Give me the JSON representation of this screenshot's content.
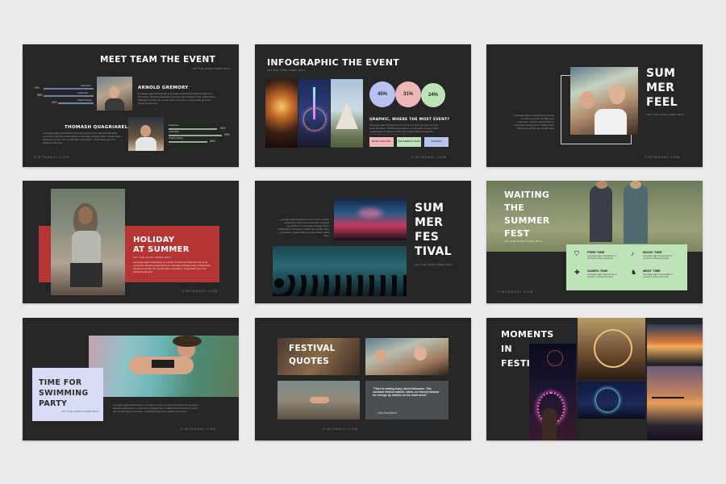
{
  "footer_url": "XINTAMANI.COM",
  "tagline": "LET THE GOOD TIMES ROLL",
  "lorem": "Leverage agile frameworks to provide a robust synopsis for high level overviews. Iterative approaches to corporate strategy foster collaborative thinking to further the overall value proposition. Organically grow the holistic world view.",
  "slide1": {
    "title": "MEET TEAM THE EVENT",
    "person1": "ARNOLD GREMORY",
    "person2": "THOMASH QUAGRIARELA",
    "pct1": [
      "70%",
      "85%",
      "60%"
    ],
    "pct2": [
      "80%",
      "90%",
      "65%"
    ],
    "skills": [
      "Ilustrations",
      "Leadership",
      "Graphic Design"
    ],
    "colors": {
      "bar_a": "#6f80a8",
      "bar_b": "#8fb08b"
    }
  },
  "slide2": {
    "title": "INFOGRAPHIC THE EVENT",
    "bubbles": [
      {
        "value": "45%",
        "color": "#b9c3f2"
      },
      {
        "value": "31%",
        "color": "#efb7b9"
      },
      {
        "value": "24%",
        "color": "#bfe3b8"
      }
    ],
    "question": "GRAPHIC, WHERE THE MOST EVENT?",
    "chips": [
      {
        "label": "MUSIC FESTIVAL",
        "color": "#efb7b9"
      },
      {
        "label": "AMUSEMENT PARK",
        "color": "#bfe3b8"
      },
      {
        "label": "CAMPING",
        "color": "#b9c3f2"
      }
    ]
  },
  "slide3": {
    "title_lines": [
      "SUM",
      "MER",
      "FEEL"
    ]
  },
  "slide4": {
    "title_lines": [
      "HOLIDAY",
      "AT SUMMER"
    ],
    "accent": "#b53535"
  },
  "slide5": {
    "title_lines": [
      "SUM",
      "MER",
      "FES",
      "TIVAL"
    ]
  },
  "slide6": {
    "title_lines": [
      "WAITING",
      "THE",
      "SUMMER",
      "FEST"
    ],
    "panel_color": "#bfe3b8",
    "items": [
      {
        "title": "FREE TIME",
        "icon": "shield-icon",
        "glyph": "⛉"
      },
      {
        "title": "MUSIC TIME",
        "icon": "music-note-icon",
        "glyph": "♪"
      },
      {
        "title": "GAMES TIME",
        "icon": "puzzle-icon",
        "glyph": "✚"
      },
      {
        "title": "MEAT TIME",
        "icon": "cow-icon",
        "glyph": "♞"
      }
    ],
    "item_text": "Leverage agile frameworks to provide a robust synopsis."
  },
  "slide7": {
    "title_lines": [
      "TIME FOR",
      "SWIMMING",
      "PARTY"
    ],
    "panel_color": "#d9dcf5"
  },
  "slide8": {
    "title_lines": [
      "FESTIVAL",
      "QUOTES"
    ],
    "quote": "\"There is nothing funny about Halloween. This sarcastic festival reflects, rather, an infernal demand for revenge by children on the adult world.\"",
    "author": "- Jean Baudrillard"
  },
  "slide9": {
    "title_lines": [
      "MOMENTS",
      "IN",
      "FESTIVAL"
    ]
  }
}
